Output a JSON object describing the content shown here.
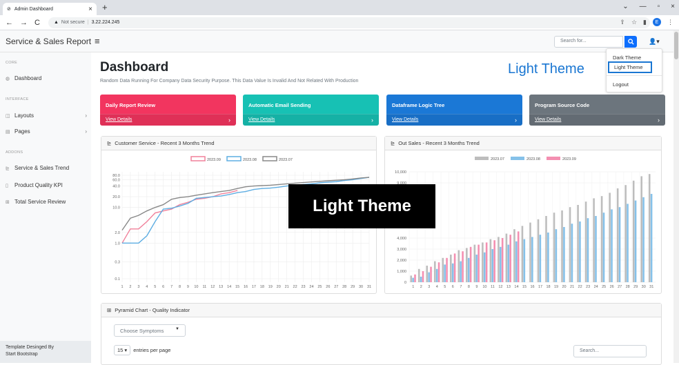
{
  "browser": {
    "tab_title": "Admin Dashboard",
    "tab_close": "×",
    "new_tab": "+",
    "not_secure": "Not secure",
    "url": "3.22.224.245",
    "win_min": "—",
    "win_max": "▫",
    "win_close": "×",
    "profile_initial": "E"
  },
  "topnav": {
    "brand": "Service & Sales Report",
    "toggler": "≡",
    "search_placeholder": "Search for...",
    "user_caret": "▾"
  },
  "sidebar": {
    "core_heading": "CORE",
    "dashboard": "Dashboard",
    "interface_heading": "INTERFACE",
    "layouts": "Layouts",
    "pages": "Pages",
    "addons_heading": "ADDONS",
    "addons": [
      "Service & Sales Trend",
      "Product Quality KPI",
      "Total Service Review"
    ],
    "footer_line1": "Template Desinged By",
    "footer_line2": "Start Bootstrap"
  },
  "main": {
    "title": "Dashboard",
    "subtitle": "Random Data Running For Company Data Security Purpose. This Data Value Is Invalid And Not Related With Production",
    "theme_label": "Light Theme",
    "overlay_label": "Light Theme"
  },
  "user_menu": {
    "items": [
      "Dark Theme",
      "Light Theme",
      "Logout"
    ],
    "active": "Light Theme"
  },
  "cards": [
    {
      "title": "Daily Report Review",
      "link": "View Details",
      "color": "#f2355f"
    },
    {
      "title": "Automatic Email Sending",
      "link": "View Details",
      "color": "#17c1b4"
    },
    {
      "title": "Dataframe Logic Tree",
      "link": "View Details",
      "color": "#1b78d6"
    },
    {
      "title": "Program Source Code",
      "link": "View Details",
      "color": "#6c757d"
    }
  ],
  "panels": {
    "customer_service": "Customer Service - Recent 3 Months Trend",
    "out_sales": "Out Sales - Recent 3 Months Trend",
    "pyramid": "Pyramid Chart - Quality Indicator",
    "select_placeholder": "Choose Symptoms",
    "entries_value": "15",
    "entries_label": "entries per page",
    "table_search": "Search..."
  },
  "chart_data": [
    {
      "type": "line",
      "title": "Customer Service - Recent 3 Months Trend",
      "x": [
        1,
        2,
        3,
        4,
        5,
        6,
        7,
        8,
        9,
        10,
        11,
        12,
        13,
        14,
        15,
        16,
        17,
        18,
        19,
        20,
        21,
        22,
        23,
        24,
        25,
        26,
        27,
        28,
        29,
        30,
        31
      ],
      "y_scale": "log",
      "y_ticks": [
        "0.1",
        "0.3",
        "1.0",
        "2.0",
        "10.0",
        "20.0",
        "40.0",
        "60.0",
        "80.0"
      ],
      "y_tick_values": [
        0.1,
        0.3,
        1,
        2,
        10,
        20,
        40,
        60,
        80
      ],
      "legend_position": "top-center",
      "series": [
        {
          "name": "2023.09",
          "color": "#f0809a",
          "values": [
            1,
            2.5,
            2.5,
            4,
            7,
            8,
            9,
            12,
            14,
            17,
            18,
            20,
            24,
            26,
            30
          ]
        },
        {
          "name": "2023.08",
          "color": "#5dade2",
          "values": [
            1,
            1,
            1,
            1.6,
            4,
            9,
            9.5,
            11,
            13,
            18,
            19,
            20,
            21,
            23,
            26,
            28,
            32,
            34,
            35,
            37,
            40,
            42,
            44,
            46,
            49,
            51,
            53,
            57,
            60,
            65,
            70
          ]
        },
        {
          "name": "2023.07",
          "color": "#888888",
          "values": [
            2.3,
            5,
            6,
            8,
            10,
            12,
            17,
            19,
            20,
            22,
            24,
            26,
            28,
            30,
            34,
            38,
            40,
            41,
            42,
            44,
            46,
            48,
            50,
            52,
            54,
            56,
            58,
            60,
            63,
            67,
            70
          ]
        }
      ]
    },
    {
      "type": "bar",
      "title": "Out Sales - Recent 3 Months Trend",
      "categories": [
        1,
        2,
        3,
        4,
        5,
        6,
        7,
        8,
        9,
        10,
        11,
        12,
        13,
        14,
        15,
        16,
        17,
        18,
        19,
        20,
        21,
        22,
        23,
        24,
        25,
        26,
        27,
        28,
        29,
        30,
        31
      ],
      "ylim": [
        0,
        10000
      ],
      "y_ticks": [
        "0",
        "1,000",
        "2,000",
        "3,000",
        "4,000",
        "9,000",
        "10,000"
      ],
      "legend_position": "top-center",
      "series": [
        {
          "name": "2023.07",
          "color": "#bdbdbd",
          "values": [
            600,
            1200,
            1500,
            1900,
            2200,
            2500,
            2900,
            3100,
            3400,
            3600,
            3900,
            4100,
            4400,
            4800,
            5100,
            5400,
            5700,
            6000,
            6300,
            6500,
            6800,
            7000,
            7300,
            7600,
            7800,
            8100,
            8500,
            8800,
            9200,
            9600,
            9800
          ]
        },
        {
          "name": "2023.08",
          "color": "#85c1e9",
          "values": [
            400,
            500,
            900,
            1200,
            1600,
            1700,
            1900,
            2200,
            2500,
            2700,
            3000,
            3200,
            3400,
            3700,
            3900,
            4100,
            4300,
            4500,
            4800,
            5000,
            5300,
            5500,
            5800,
            6000,
            6300,
            6600,
            6800,
            7100,
            7400,
            7700,
            8000
          ]
        },
        {
          "name": "2023.09",
          "color": "#f48fb1",
          "values": [
            700,
            1000,
            1400,
            1800,
            2200,
            2600,
            2800,
            3200,
            3400,
            3600,
            3800,
            4000,
            4300,
            4600
          ]
        }
      ]
    }
  ]
}
